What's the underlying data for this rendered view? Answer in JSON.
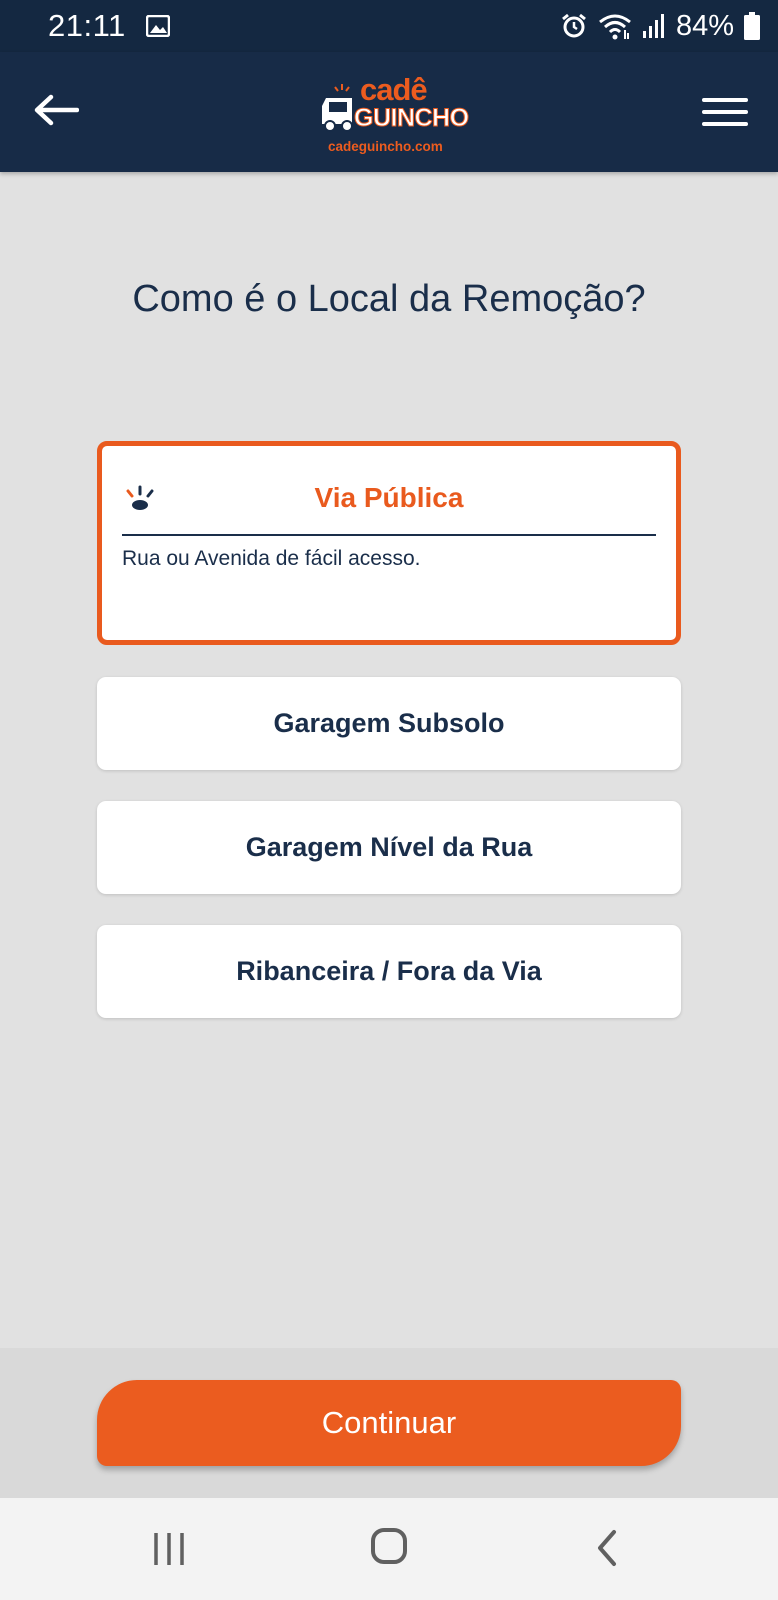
{
  "status_bar": {
    "time": "21:11",
    "battery": "84%",
    "icons": [
      "image-icon",
      "alarm-icon",
      "wifi-icon",
      "signal-icon",
      "battery-icon"
    ]
  },
  "header": {
    "logo_top": "cadê",
    "logo_main": "GUINCHO",
    "logo_url": "cadeguincho.com",
    "icons": [
      "back-arrow-icon",
      "hamburger-menu-icon"
    ]
  },
  "page": {
    "title": "Como é o Local da Remoção?"
  },
  "options": {
    "selected": {
      "title": "Via Pública",
      "description": "Rua ou Avenida de fácil acesso.",
      "icon": "beacon-light-icon"
    },
    "items": [
      {
        "label": "Garagem Subsolo"
      },
      {
        "label": "Garagem Nível da Rua"
      },
      {
        "label": "Ribanceira / Fora da Via"
      }
    ]
  },
  "actions": {
    "continue_label": "Continuar"
  },
  "colors": {
    "accent": "#eb5c1f",
    "navy": "#172b47",
    "text": "#1a2e4a",
    "background": "#e1e1e1"
  }
}
